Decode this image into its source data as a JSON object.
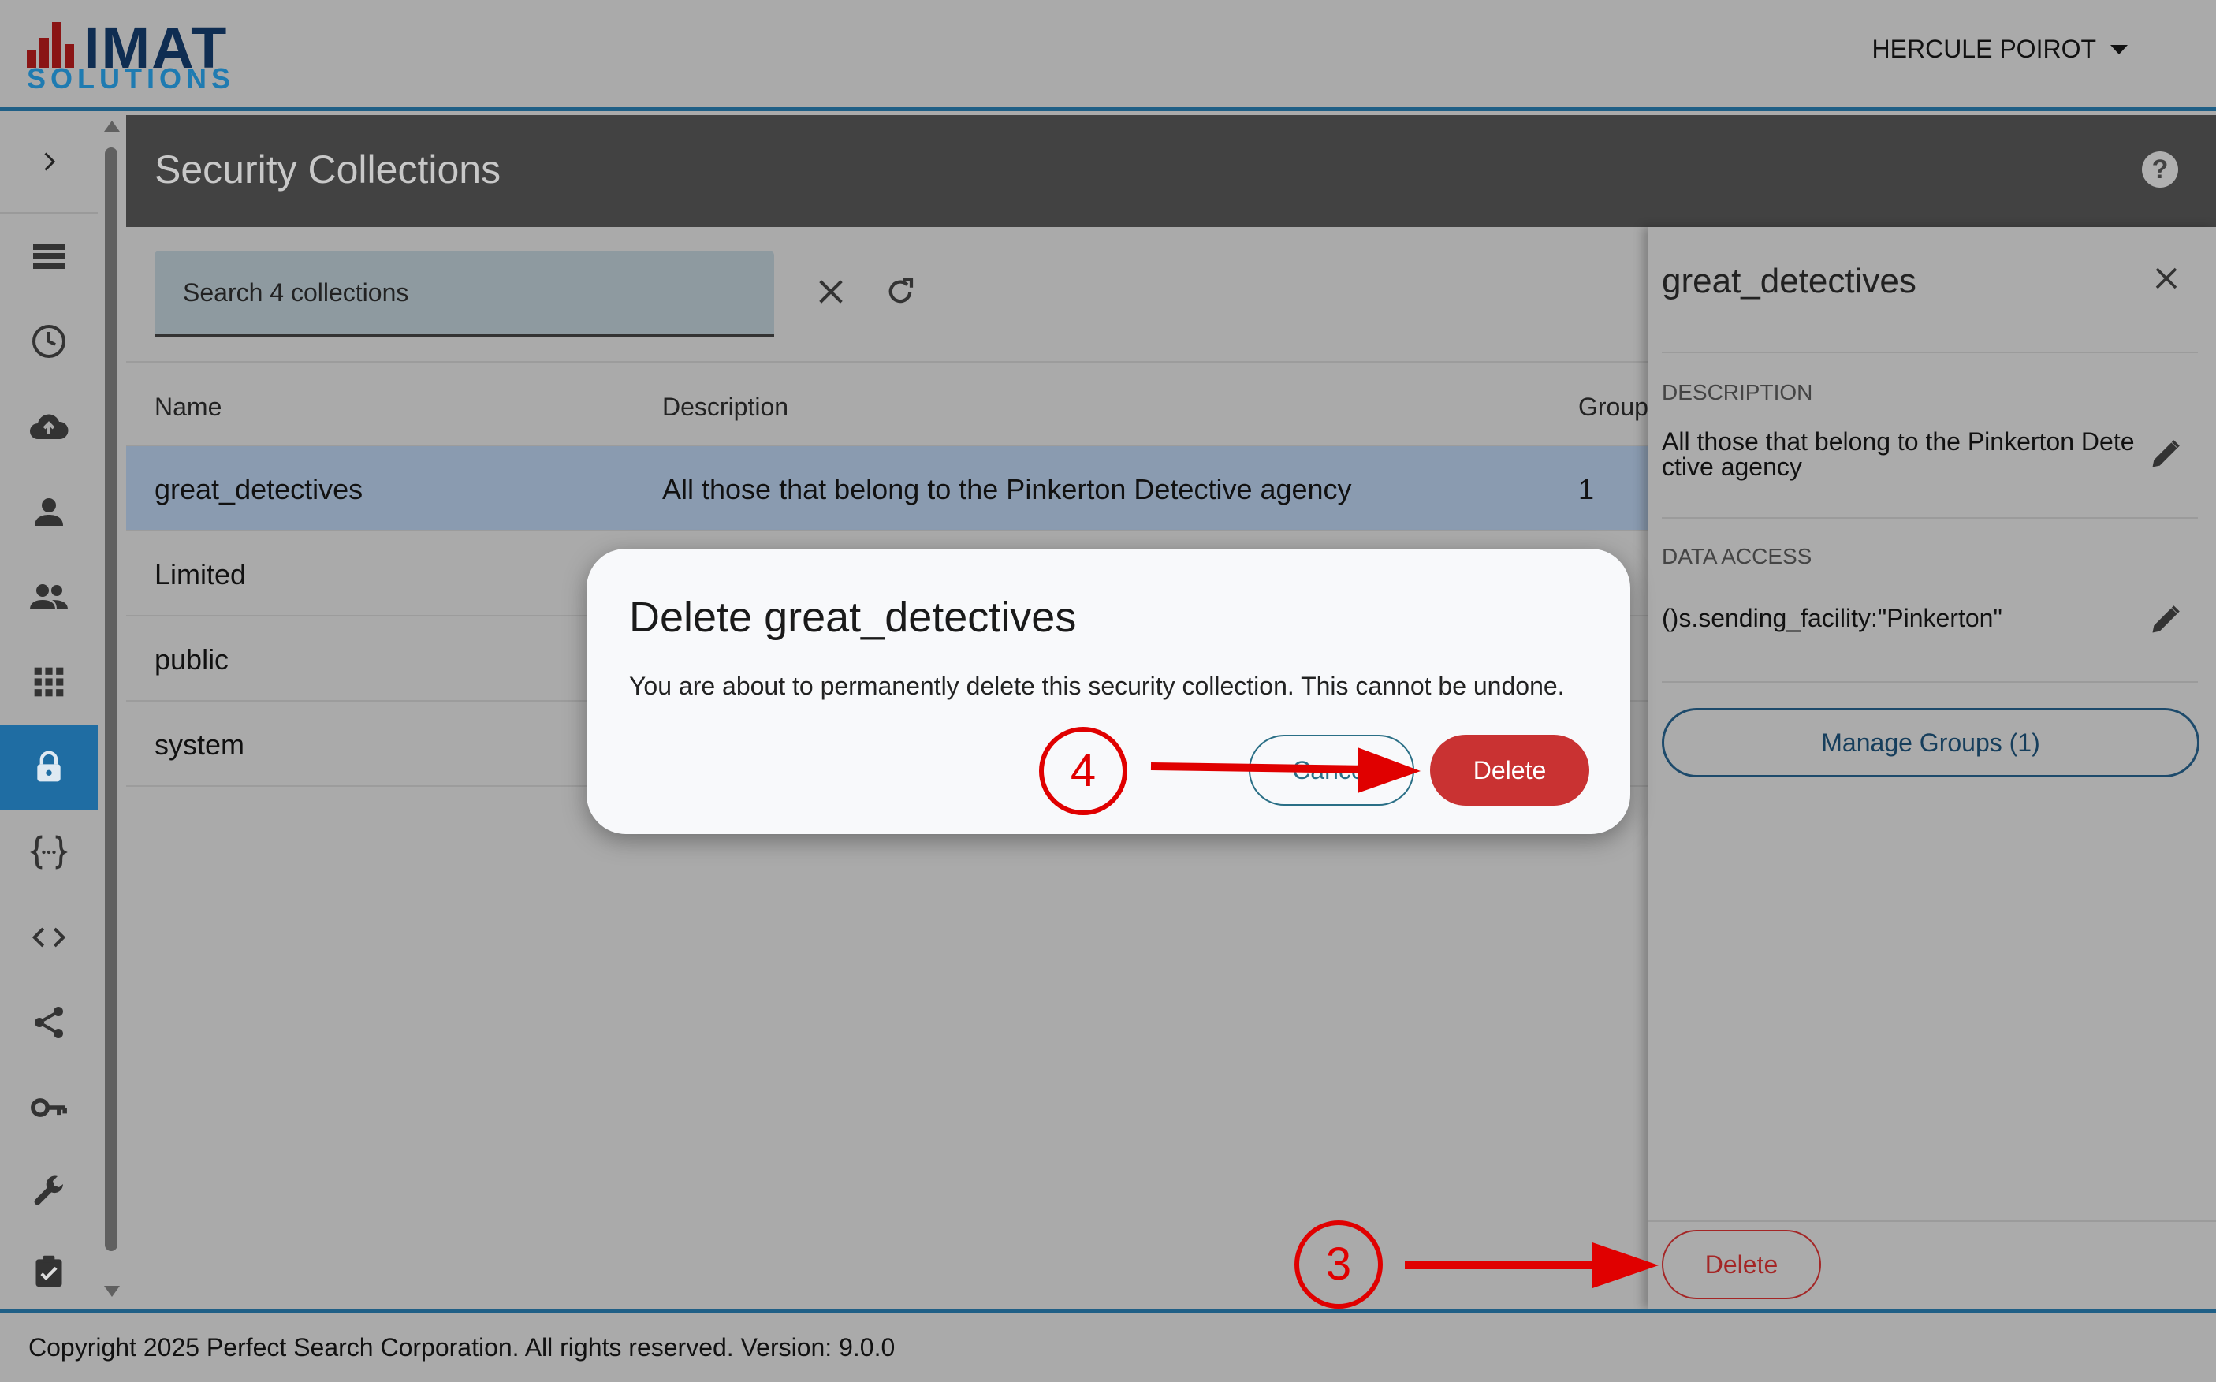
{
  "brand": {
    "logo_text": "IMAT",
    "logo_sub": "SOLUTIONS",
    "bar_color": "#8a1515",
    "text_color": "#0f2d52"
  },
  "header": {
    "user_name": "HERCULE POIROT"
  },
  "nav": {
    "items": [
      {
        "icon": "expand-chevron-icon"
      },
      {
        "icon": "list-icon"
      },
      {
        "icon": "clock-icon"
      },
      {
        "icon": "cloud-upload-icon"
      },
      {
        "icon": "person-icon"
      },
      {
        "icon": "group-icon"
      },
      {
        "icon": "grid-icon"
      },
      {
        "icon": "lock-icon",
        "active": true
      },
      {
        "icon": "braces-icon"
      },
      {
        "icon": "code-icon"
      },
      {
        "icon": "share-icon"
      },
      {
        "icon": "key-icon"
      },
      {
        "icon": "wrench-icon"
      },
      {
        "icon": "clipboard-check-icon"
      }
    ],
    "active_color": "#1f6da3"
  },
  "page": {
    "title": "Security Collections"
  },
  "search": {
    "placeholder": "Search 4 collections"
  },
  "table": {
    "columns": [
      "Name",
      "Description",
      "Group"
    ],
    "rows": [
      {
        "name": "great_detectives",
        "description": "All those that belong to the Pinkerton Detective agency",
        "groups": "1",
        "selected": true
      },
      {
        "name": "Limited",
        "description": "",
        "groups": ""
      },
      {
        "name": "public",
        "description": "",
        "groups": ""
      },
      {
        "name": "system",
        "description": "",
        "groups": ""
      }
    ]
  },
  "panel": {
    "title": "great_detectives",
    "description_label": "DESCRIPTION",
    "description_value": "All those that belong to the Pinkerton Detective agency",
    "data_access_label": "DATA ACCESS",
    "data_access_value": "()s.sending_facility:\"Pinkerton\"",
    "manage_groups_label": "Manage Groups (1)",
    "delete_label": "Delete"
  },
  "dialog": {
    "title": "Delete great_detectives",
    "message": "You are about to permanently delete this security collection. This cannot be undone.",
    "cancel_label": "Cancel",
    "delete_label": "Delete",
    "delete_color": "#c93232"
  },
  "annotations": {
    "step_4": "4",
    "step_3": "3",
    "color": "#e00000"
  },
  "footer": {
    "copyright": "Copyright 2025 Perfect Search Corporation. All rights reserved. Version: 9.0.0"
  }
}
